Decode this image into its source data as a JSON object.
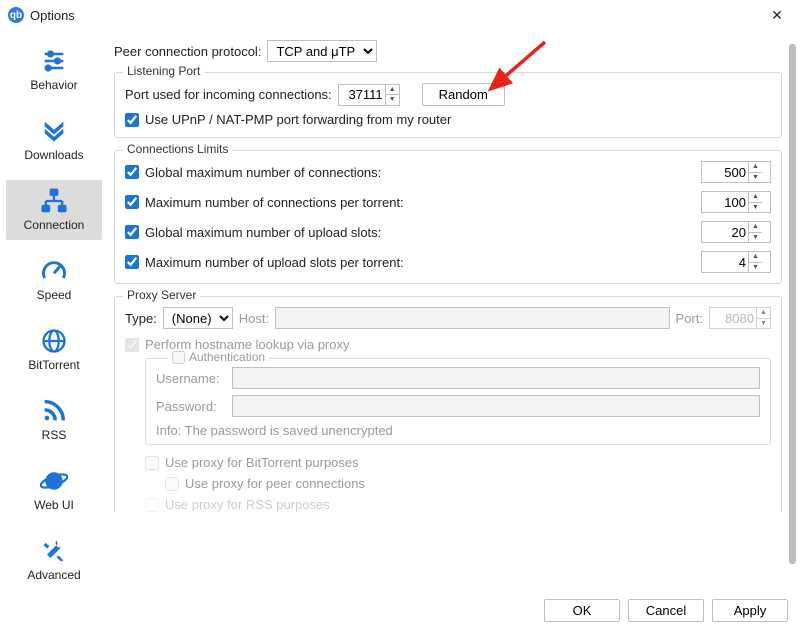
{
  "window": {
    "title": "Options"
  },
  "sidebar": {
    "items": [
      {
        "label": "Behavior",
        "icon": "sliders-icon"
      },
      {
        "label": "Downloads",
        "icon": "chevrons-down-icon"
      },
      {
        "label": "Connection",
        "icon": "network-icon"
      },
      {
        "label": "Speed",
        "icon": "gauge-icon"
      },
      {
        "label": "BitTorrent",
        "icon": "globe-icon"
      },
      {
        "label": "RSS",
        "icon": "rss-icon"
      },
      {
        "label": "Web UI",
        "icon": "planet-icon"
      },
      {
        "label": "Advanced",
        "icon": "tools-icon"
      }
    ],
    "active_index": 2
  },
  "content": {
    "peer_protocol": {
      "label": "Peer connection protocol:",
      "value": "TCP and μTP"
    },
    "listening": {
      "title": "Listening Port",
      "port_label": "Port used for incoming connections:",
      "port_value": "37111",
      "random_label": "Random",
      "upnp_checked": true,
      "upnp_label": "Use UPnP / NAT-PMP port forwarding from my router"
    },
    "limits": {
      "title": "Connections Limits",
      "rows": [
        {
          "label": "Global maximum number of connections:",
          "value": "500",
          "checked": true
        },
        {
          "label": "Maximum number of connections per torrent:",
          "value": "100",
          "checked": true
        },
        {
          "label": "Global maximum number of upload slots:",
          "value": "20",
          "checked": true
        },
        {
          "label": "Maximum number of upload slots per torrent:",
          "value": "4",
          "checked": true
        }
      ]
    },
    "proxy": {
      "title": "Proxy Server",
      "type_label": "Type:",
      "type_value": "(None)",
      "host_label": "Host:",
      "host_value": "",
      "port_label": "Port:",
      "port_value": "8080",
      "hostname_lookup_label": "Perform hostname lookup via proxy",
      "auth_label": "Authentication",
      "username_label": "Username:",
      "username_value": "",
      "password_label": "Password:",
      "password_value": "",
      "info_label": "Info: The password is saved unencrypted",
      "use_bt_label": "Use proxy for BitTorrent purposes",
      "use_peer_label": "Use proxy for peer connections",
      "use_rss_label": "Use proxy for RSS purposes"
    }
  },
  "footer": {
    "ok": "OK",
    "cancel": "Cancel",
    "apply": "Apply"
  }
}
